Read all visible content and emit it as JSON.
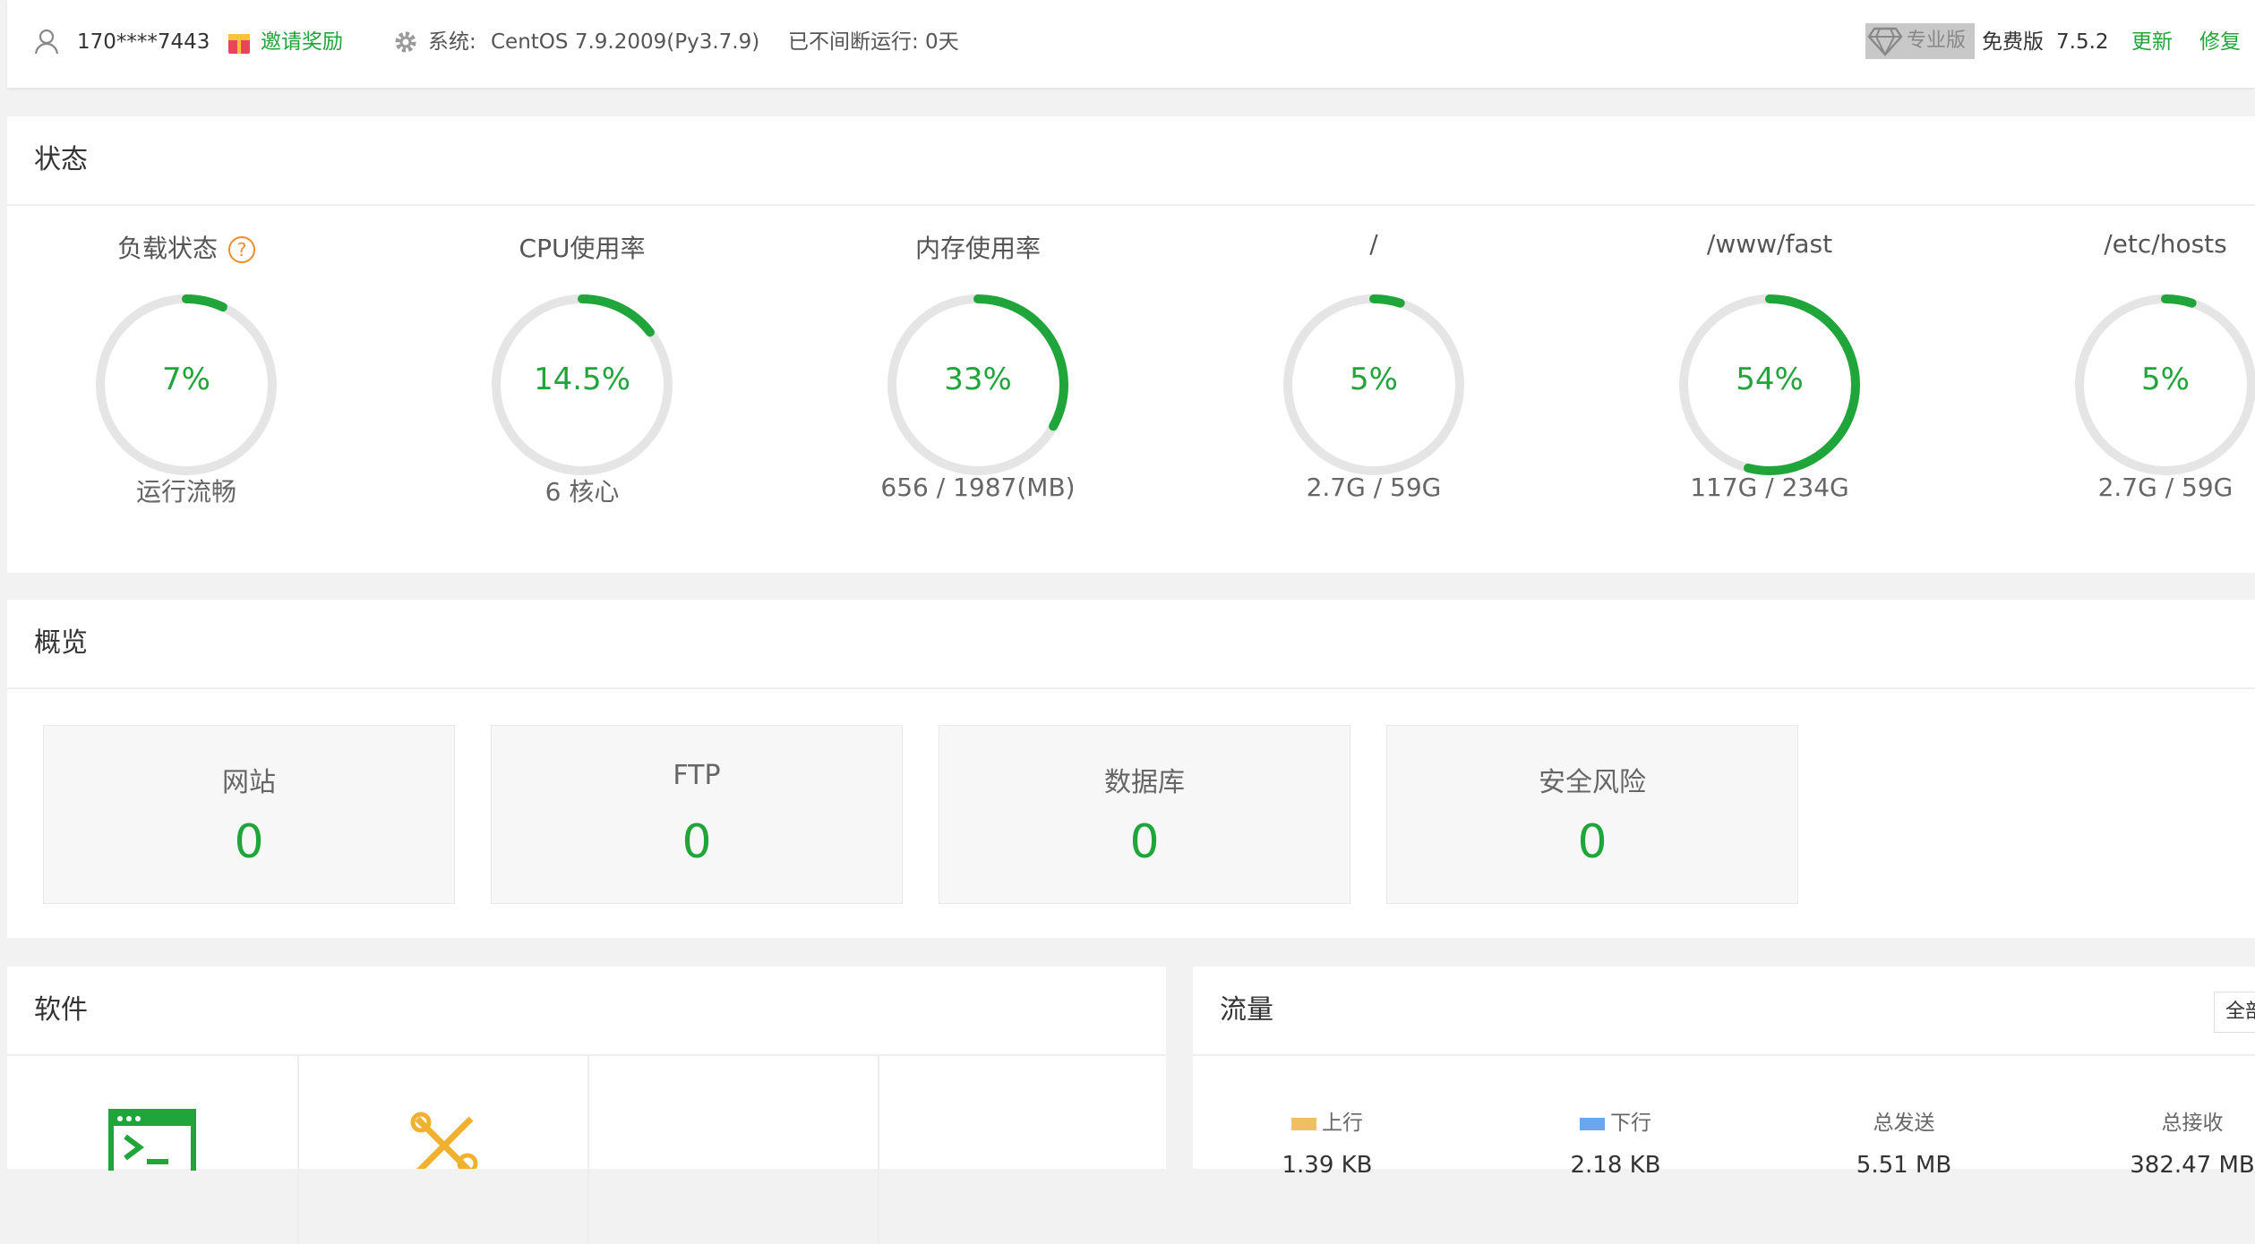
{
  "header": {
    "username": "170****7443",
    "invite_label": "邀请奖励",
    "system_label": "系统:",
    "system_value": "CentOS 7.9.2009(Py3.7.9)",
    "uptime": "已不间断运行: 0天",
    "pro_badge": "专业版",
    "edition": "免费版",
    "version": "7.5.2",
    "update_label": "更新",
    "repair_label": "修复"
  },
  "status": {
    "title": "状态",
    "gauges": [
      {
        "title": "负载状态",
        "value": "7%",
        "percent": 7,
        "subtitle": "运行流畅",
        "help": "?"
      },
      {
        "title": "CPU使用率",
        "value": "14.5%",
        "percent": 14.5,
        "subtitle": "6 核心"
      },
      {
        "title": "内存使用率",
        "value": "33%",
        "percent": 33,
        "subtitle": "656 / 1987(MB)"
      },
      {
        "title": "/",
        "value": "5%",
        "percent": 5,
        "subtitle": "2.7G / 59G"
      },
      {
        "title": "/www/fast",
        "value": "54%",
        "percent": 54,
        "subtitle": "117G / 234G"
      },
      {
        "title": "/etc/hosts",
        "value": "5%",
        "percent": 5,
        "subtitle": "2.7G / 59G"
      }
    ]
  },
  "overview": {
    "title": "概览",
    "items": [
      {
        "label": "网站",
        "value": "0"
      },
      {
        "label": "FTP",
        "value": "0"
      },
      {
        "label": "数据库",
        "value": "0"
      },
      {
        "label": "安全风险",
        "value": "0"
      }
    ]
  },
  "software": {
    "title": "软件"
  },
  "traffic": {
    "title": "流量",
    "select_value": "全部",
    "columns": [
      {
        "label": "上行",
        "value": "1.39 KB",
        "swatch": "#f0bf62"
      },
      {
        "label": "下行",
        "value": "2.18 KB",
        "swatch": "#6aa7f0"
      },
      {
        "label": "总发送",
        "value": "5.51 MB"
      },
      {
        "label": "总接收",
        "value": "382.47 MB"
      }
    ]
  },
  "colors": {
    "accent": "#20a53a",
    "ring_bg": "#e5e5e5",
    "warning": "#f08c2c"
  }
}
